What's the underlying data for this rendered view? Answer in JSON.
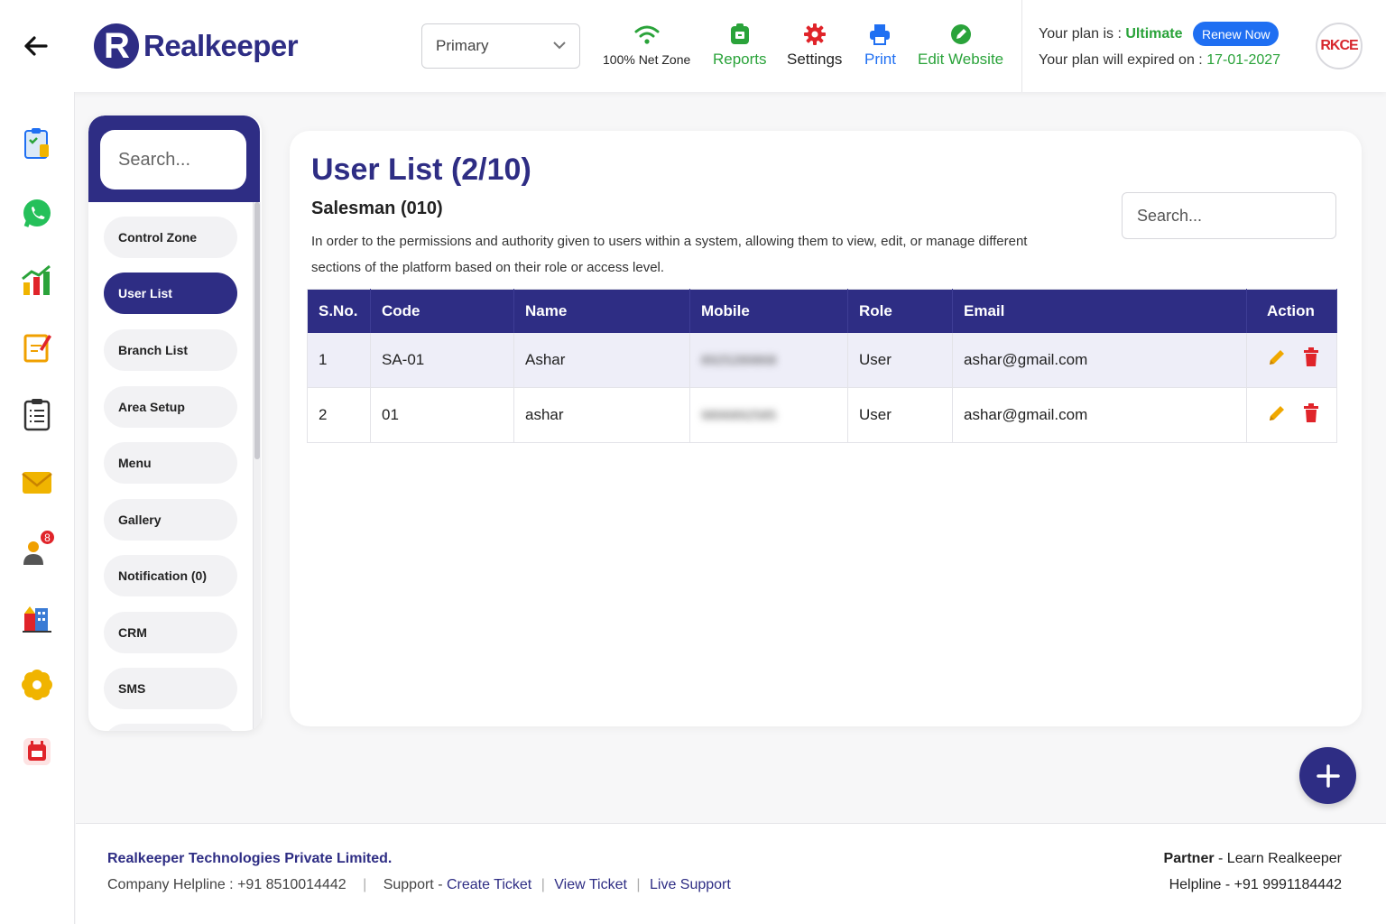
{
  "header": {
    "logo_text": "Realkeeper",
    "logo_letter": "R",
    "branch_select": "Primary",
    "net_zone": "100% Net Zone",
    "tools": {
      "reports": "Reports",
      "settings": "Settings",
      "print": "Print",
      "edit_website": "Edit Website"
    },
    "plan_label": "Your plan is :",
    "plan_name": "Ultimate",
    "renew_label": "Renew Now",
    "expiry_label": "Your plan will expired on :",
    "expiry_date": "17-01-2027",
    "avatar_text": "RKCE"
  },
  "rail": {
    "contacts_badge": "8"
  },
  "sidemenu": {
    "search_placeholder": "Search...",
    "items": [
      "Control Zone",
      "User List",
      "Branch List",
      "Area Setup",
      "Menu",
      "Gallery",
      "Notification (0)",
      "CRM",
      "SMS"
    ],
    "active_item": "User List"
  },
  "main": {
    "title": "User List (2/10)",
    "subtitle": "Salesman (010)",
    "description": "In order to the permissions and authority given to users within a system, allowing them to view, edit, or manage different sections of the platform based on their role or access level.",
    "search_placeholder": "Search...",
    "columns": [
      "S.No.",
      "Code",
      "Name",
      "Mobile",
      "Role",
      "Email",
      "Action"
    ],
    "rows": [
      {
        "sno": "1",
        "code": "SA-01",
        "name": "Ashar",
        "mobile": "8925289868",
        "role": "User",
        "email": "ashar@gmail.com"
      },
      {
        "sno": "2",
        "code": "01",
        "name": "ashar",
        "mobile": "9896892585",
        "role": "User",
        "email": "ashar@gmail.com"
      }
    ]
  },
  "footer": {
    "company": "Realkeeper Technologies Private Limited.",
    "helpline_label": "Company Helpline : +91 8510014442",
    "support_label": "Support -",
    "create_ticket": "Create Ticket",
    "view_ticket": "View Ticket",
    "live_support": "Live Support",
    "partner_bold": "Partner",
    "partner_rest": " - Learn Realkeeper",
    "helpline_right": "Helpline - +91 9991184442"
  },
  "colors": {
    "brand": "#2e2d84",
    "accent_green": "#2aa33a",
    "renew_blue": "#1f6ff2",
    "danger": "#e0242a"
  }
}
